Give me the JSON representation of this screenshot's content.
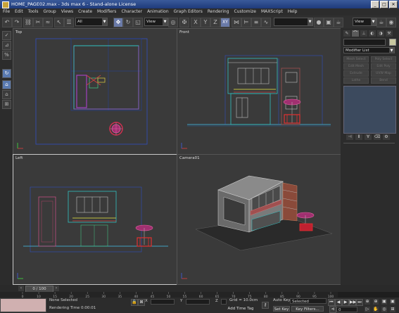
{
  "app": {
    "title": "HOME_PAGE02.max - 3ds max 6 - Stand-alone License"
  },
  "window_buttons": [
    "_",
    "□",
    "✕"
  ],
  "menu": [
    "File",
    "Edit",
    "Tools",
    "Group",
    "Views",
    "Create",
    "Modifiers",
    "Character",
    "Animation",
    "Graph Editors",
    "Rendering",
    "Customize",
    "MAXScript",
    "Help"
  ],
  "toolbar": {
    "selection_filter": "All",
    "ref_coord": "View",
    "axis_x": "X",
    "axis_y": "Y",
    "axis_z": "Z",
    "axis_xy": "XY",
    "named_selection": "",
    "render_dropdown": "View"
  },
  "viewports": {
    "top": {
      "label": "Top"
    },
    "front": {
      "label": "Front"
    },
    "left": {
      "label": "Left"
    },
    "camera": {
      "label": "Camera01"
    }
  },
  "command_panel": {
    "modifier_list": "Modifier List",
    "modifier_buttons": [
      "Mesh Select",
      "Poly Select",
      "Edit Mesh",
      "Edit Poly",
      "Extrude",
      "UVW Map",
      "Lathe",
      "Bend"
    ]
  },
  "timeline": {
    "frame_indicator": "0 / 100",
    "ticks": [
      "0",
      "10",
      "15",
      "20",
      "25",
      "30",
      "35",
      "40",
      "45",
      "50",
      "55",
      "60",
      "65",
      "70",
      "75",
      "80",
      "85",
      "90",
      "95",
      "100"
    ]
  },
  "status": {
    "selection": "None Selected",
    "render_time": "Rendering Time 0:00:01",
    "x_label": "X",
    "y_label": "Y",
    "z_label": "Z",
    "grid": "Grid = 10.0cm",
    "add_time_tag": "Add Time Tag",
    "auto_key": "Auto Key",
    "auto_key_value": "Selected",
    "set_key": "Set Key",
    "key_filters": "Key Filters...",
    "current_frame": "0"
  },
  "colors": {
    "accent": "#5a7ab0",
    "viewport_bg": "#3a3a3a",
    "active_border": "#c8c8c8"
  }
}
